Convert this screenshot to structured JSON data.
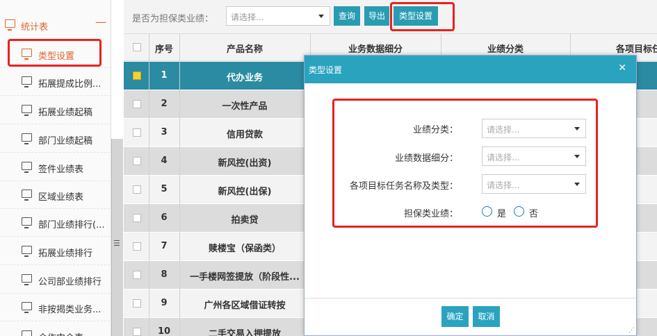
{
  "sidebar": {
    "group_label": "统计表",
    "group_toggle": "—",
    "items": [
      {
        "label": "类型设置",
        "active": true
      },
      {
        "label": "拓展提成比例..."
      },
      {
        "label": "拓展业绩起稿"
      },
      {
        "label": "部门业绩起稿"
      },
      {
        "label": "签件业绩表"
      },
      {
        "label": "区域业绩表"
      },
      {
        "label": "部门业绩排行(..."
      },
      {
        "label": "拓展业绩排行"
      },
      {
        "label": "公司部业绩排行"
      },
      {
        "label": "非按揭类业务..."
      },
      {
        "label": "合作中介表"
      }
    ],
    "resize_handle": "☰"
  },
  "toolbar": {
    "filter_label": "是否为担保类业绩：",
    "filter_placeholder": "请选择...",
    "query_label": "查询",
    "export_label": "导出",
    "type_setting_label": "类型设置"
  },
  "table": {
    "headers": [
      "序号",
      "产品名称",
      "业务数据细分",
      "业绩分类",
      "各项目标任"
    ],
    "rows": [
      {
        "no": "1",
        "name": "代办业务",
        "selected": true
      },
      {
        "no": "2",
        "name": "一次性产品"
      },
      {
        "no": "3",
        "name": "信用贷款"
      },
      {
        "no": "4",
        "name": "新风控(出资)"
      },
      {
        "no": "5",
        "name": "新风控(出保)"
      },
      {
        "no": "6",
        "name": "拍卖贷"
      },
      {
        "no": "7",
        "name": "赎楼宝（保函类）"
      },
      {
        "no": "8",
        "name": "一手楼网签提放（阶段性..."
      },
      {
        "no": "9",
        "name": "广州各区域借证转按"
      },
      {
        "no": "10",
        "name": "二手交易入押提放"
      }
    ]
  },
  "modal": {
    "title": "类型设置",
    "close_glyph": "✕",
    "fields": {
      "category_label": "业绩分类：",
      "category_placeholder": "请选择...",
      "detail_label": "业绩数据细分：",
      "detail_placeholder": "请选择...",
      "target_label": "各项目标任务名称及类型：",
      "target_placeholder": "请选择...",
      "guarantee_label": "担保类业绩：",
      "option_yes": "是",
      "option_no": "否"
    },
    "ok_label": "确定",
    "cancel_label": "取消",
    "grip_glyph": "⋰"
  },
  "colors": {
    "accent": "#2a9cb2",
    "header": "#2aa3bf",
    "highlight_box": "#e8211c",
    "sidebar_active": "#e0662a",
    "selected_row": "#2a8ba2"
  }
}
